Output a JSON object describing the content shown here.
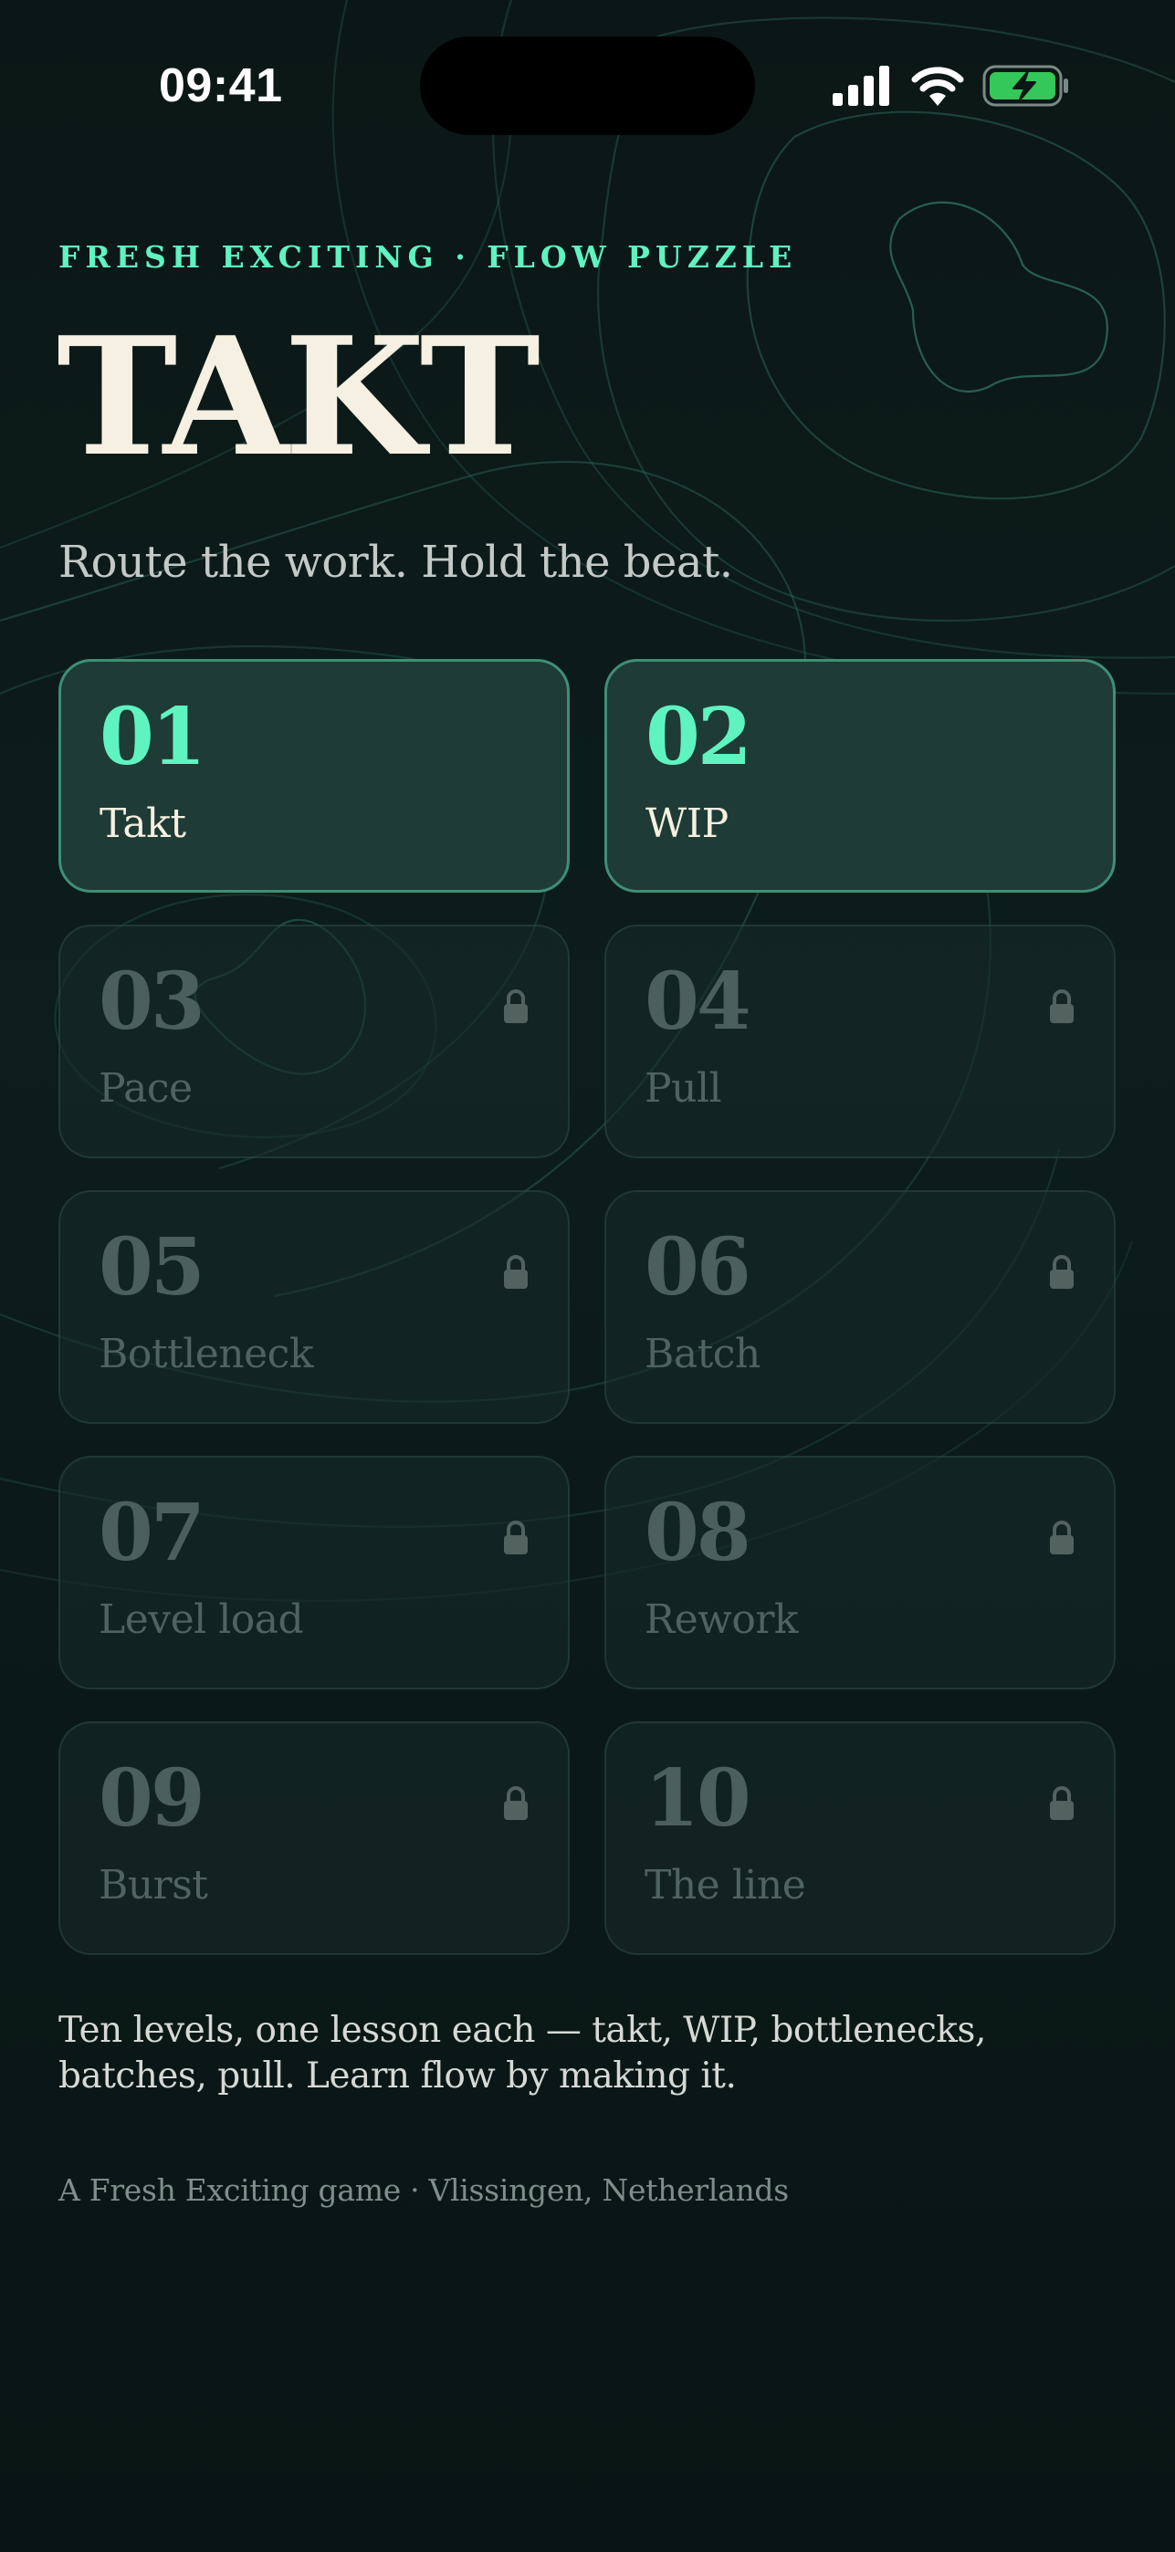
{
  "status_bar": {
    "time": "09:41",
    "icons": [
      "signal-icon",
      "wifi-icon",
      "battery-charging-icon"
    ]
  },
  "header": {
    "eyebrow": "FRESH EXCITING · FLOW PUZZLE",
    "title": "TAKT",
    "tagline": "Route the work. Hold the beat."
  },
  "levels": [
    {
      "number": "01",
      "name": "Takt",
      "locked": false
    },
    {
      "number": "02",
      "name": "WIP",
      "locked": false
    },
    {
      "number": "03",
      "name": "Pace",
      "locked": true
    },
    {
      "number": "04",
      "name": "Pull",
      "locked": true
    },
    {
      "number": "05",
      "name": "Bottleneck",
      "locked": true
    },
    {
      "number": "06",
      "name": "Batch",
      "locked": true
    },
    {
      "number": "07",
      "name": "Level load",
      "locked": true
    },
    {
      "number": "08",
      "name": "Rework",
      "locked": true
    },
    {
      "number": "09",
      "name": "Burst",
      "locked": true
    },
    {
      "number": "10",
      "name": "The line",
      "locked": true
    }
  ],
  "footer": {
    "description": "Ten levels, one lesson each — takt, WIP, bottlenecks, batches, pull. Learn flow by making it.",
    "credit": "A Fresh Exciting game · Vlissingen, Netherlands"
  },
  "colors": {
    "background": "#0b1716",
    "accent": "#5ff3c0",
    "title": "#f5f0e1",
    "battery_fill": "#34c759"
  }
}
